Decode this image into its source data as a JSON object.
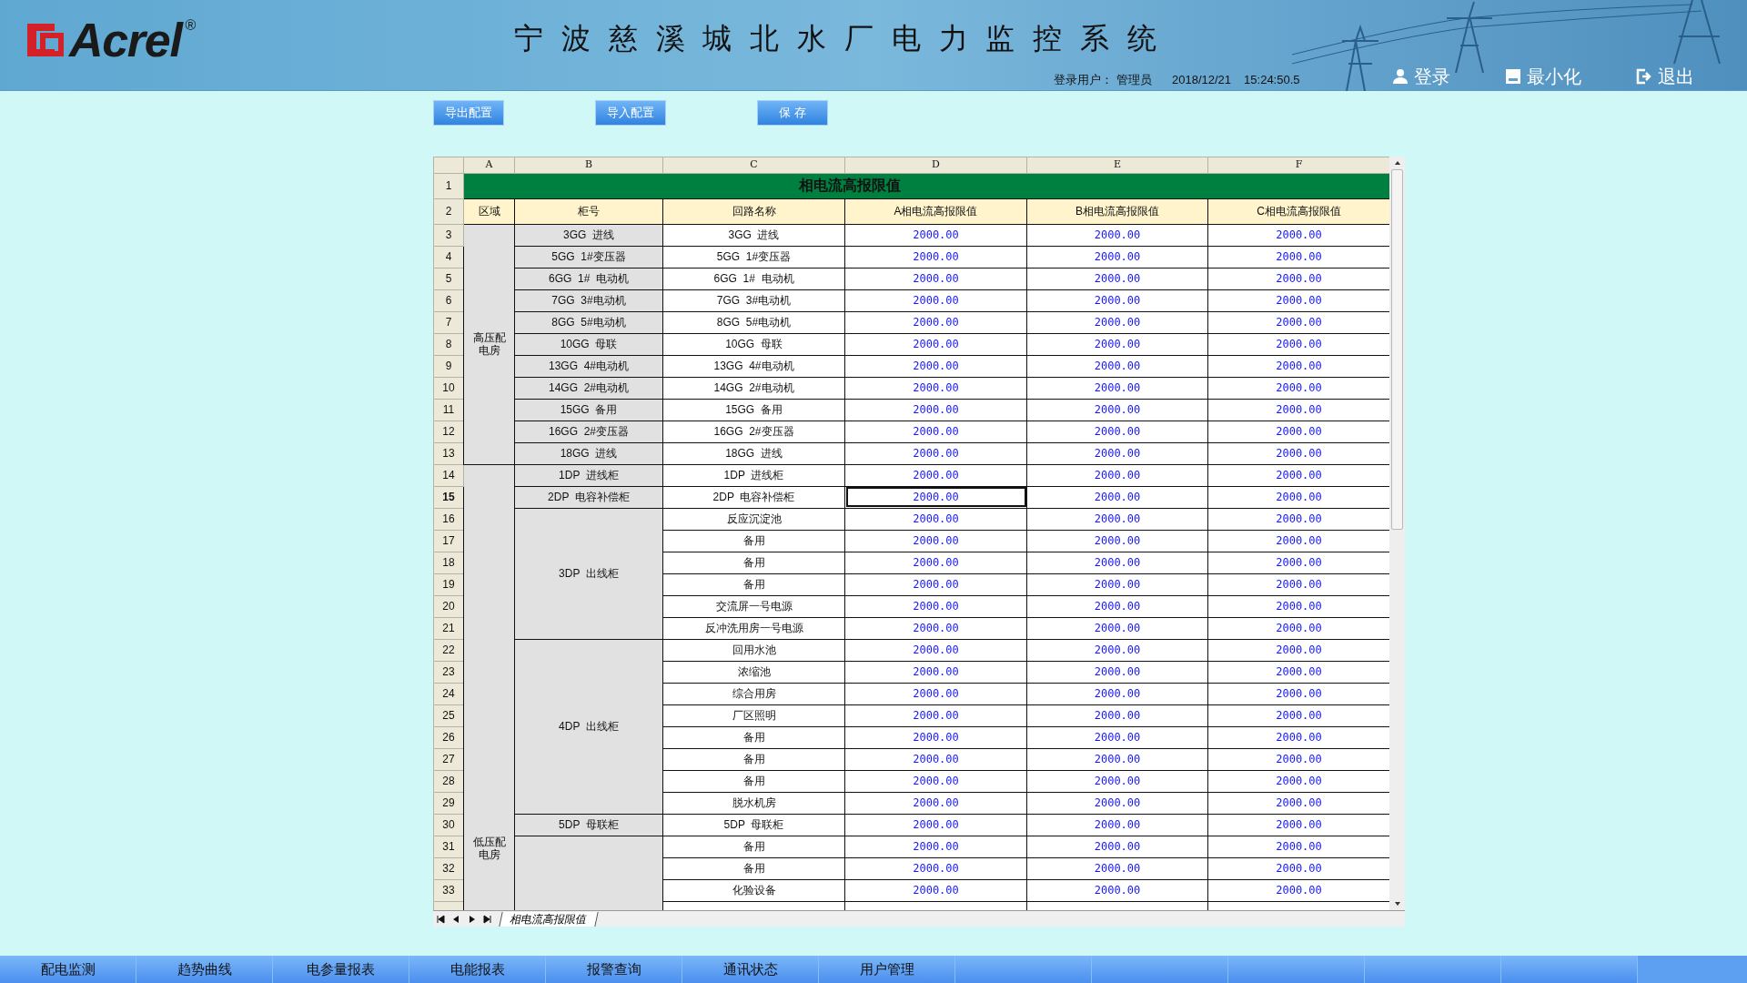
{
  "header": {
    "logo": "Acrel",
    "registered_mark": "®",
    "title": "宁波慈溪城北水厂电力监控系统",
    "user_label": "登录用户：",
    "user": "管理员",
    "date": "2018/12/21",
    "time": "15:24:50.5",
    "actions": [
      {
        "kind": "login",
        "label": "登录"
      },
      {
        "kind": "minimize",
        "label": "最小化"
      },
      {
        "kind": "exit",
        "label": "退出"
      }
    ]
  },
  "toolbar": [
    "导出配置",
    "导入配置",
    "保 存"
  ],
  "sheet": {
    "column_letters": [
      "A",
      "B",
      "C",
      "D",
      "E",
      "F"
    ],
    "row_numbers": [
      "1",
      "2",
      "3",
      "4",
      "5",
      "6",
      "7",
      "8",
      "9",
      "10",
      "11",
      "12",
      "13",
      "14",
      "15",
      "16",
      "17",
      "18",
      "19",
      "20",
      "21",
      "22",
      "23",
      "24",
      "25",
      "26",
      "27",
      "28",
      "29",
      "30",
      "31",
      "32",
      "33"
    ],
    "title": "相电流高报限值",
    "headers": [
      "区域",
      "柜号",
      "回路名称",
      "A相电流高报限值",
      "B相电流高报限值",
      "C相电流高报限值"
    ],
    "regions": [
      {
        "name": "高压配电房",
        "cabinets": [
          {
            "name": "3GG  进线",
            "circuits": [
              {
                "name": "3GG  进线",
                "a": "2000.00",
                "b": "2000.00",
                "c": "2000.00",
                "selected": false
              }
            ]
          },
          {
            "name": "5GG  1#变压器",
            "circuits": [
              {
                "name": "5GG  1#变压器",
                "a": "2000.00",
                "b": "2000.00",
                "c": "2000.00",
                "selected": false
              }
            ]
          },
          {
            "name": "6GG  1#  电动机",
            "circuits": [
              {
                "name": "6GG  1#  电动机",
                "a": "2000.00",
                "b": "2000.00",
                "c": "2000.00",
                "selected": false
              }
            ]
          },
          {
            "name": "7GG  3#电动机",
            "circuits": [
              {
                "name": "7GG  3#电动机",
                "a": "2000.00",
                "b": "2000.00",
                "c": "2000.00",
                "selected": false
              }
            ]
          },
          {
            "name": "8GG  5#电动机",
            "circuits": [
              {
                "name": "8GG  5#电动机",
                "a": "2000.00",
                "b": "2000.00",
                "c": "2000.00",
                "selected": false
              }
            ]
          },
          {
            "name": "10GG  母联",
            "circuits": [
              {
                "name": "10GG  母联",
                "a": "2000.00",
                "b": "2000.00",
                "c": "2000.00",
                "selected": false
              }
            ]
          },
          {
            "name": "13GG  4#电动机",
            "circuits": [
              {
                "name": "13GG  4#电动机",
                "a": "2000.00",
                "b": "2000.00",
                "c": "2000.00",
                "selected": false
              }
            ]
          },
          {
            "name": "14GG  2#电动机",
            "circuits": [
              {
                "name": "14GG  2#电动机",
                "a": "2000.00",
                "b": "2000.00",
                "c": "2000.00",
                "selected": false
              }
            ]
          },
          {
            "name": "15GG  备用",
            "circuits": [
              {
                "name": "15GG  备用",
                "a": "2000.00",
                "b": "2000.00",
                "c": "2000.00",
                "selected": false
              }
            ]
          },
          {
            "name": "16GG  2#变压器",
            "circuits": [
              {
                "name": "16GG  2#变压器",
                "a": "2000.00",
                "b": "2000.00",
                "c": "2000.00",
                "selected": false
              }
            ]
          },
          {
            "name": "18GG  进线",
            "circuits": [
              {
                "name": "18GG  进线",
                "a": "2000.00",
                "b": "2000.00",
                "c": "2000.00",
                "selected": false
              }
            ]
          }
        ]
      },
      {
        "name": "低压配电房",
        "cabinets": [
          {
            "name": "1DP  进线柜",
            "circuits": [
              {
                "name": "1DP  进线柜",
                "a": "2000.00",
                "b": "2000.00",
                "c": "2000.00",
                "selected": false
              }
            ]
          },
          {
            "name": "2DP  电容补偿柜",
            "circuits": [
              {
                "name": "2DP  电容补偿柜",
                "a": "2000.00",
                "b": "2000.00",
                "c": "2000.00",
                "selected": true
              }
            ]
          },
          {
            "name": "3DP  出线柜",
            "circuits": [
              {
                "name": "反应沉淀池",
                "a": "2000.00",
                "b": "2000.00",
                "c": "2000.00",
                "selected": false
              },
              {
                "name": "备用",
                "a": "2000.00",
                "b": "2000.00",
                "c": "2000.00",
                "selected": false
              },
              {
                "name": "备用",
                "a": "2000.00",
                "b": "2000.00",
                "c": "2000.00",
                "selected": false
              },
              {
                "name": "备用",
                "a": "2000.00",
                "b": "2000.00",
                "c": "2000.00",
                "selected": false
              },
              {
                "name": "交流屏一号电源",
                "a": "2000.00",
                "b": "2000.00",
                "c": "2000.00",
                "selected": false
              },
              {
                "name": "反冲洗用房一号电源",
                "a": "2000.00",
                "b": "2000.00",
                "c": "2000.00",
                "selected": false
              }
            ]
          },
          {
            "name": "4DP  出线柜",
            "circuits": [
              {
                "name": "回用水池",
                "a": "2000.00",
                "b": "2000.00",
                "c": "2000.00",
                "selected": false
              },
              {
                "name": "浓缩池",
                "a": "2000.00",
                "b": "2000.00",
                "c": "2000.00",
                "selected": false
              },
              {
                "name": "综合用房",
                "a": "2000.00",
                "b": "2000.00",
                "c": "2000.00",
                "selected": false
              },
              {
                "name": "厂区照明",
                "a": "2000.00",
                "b": "2000.00",
                "c": "2000.00",
                "selected": false
              },
              {
                "name": "备用",
                "a": "2000.00",
                "b": "2000.00",
                "c": "2000.00",
                "selected": false
              },
              {
                "name": "备用",
                "a": "2000.00",
                "b": "2000.00",
                "c": "2000.00",
                "selected": false
              },
              {
                "name": "备用",
                "a": "2000.00",
                "b": "2000.00",
                "c": "2000.00",
                "selected": false
              },
              {
                "name": "脱水机房",
                "a": "2000.00",
                "b": "2000.00",
                "c": "2000.00",
                "selected": false
              }
            ]
          },
          {
            "name": "5DP  母联柜",
            "circuits": [
              {
                "name": "5DP  母联柜",
                "a": "2000.00",
                "b": "2000.00",
                "c": "2000.00",
                "selected": false
              }
            ]
          },
          {
            "circuits": [
              {
                "name": "备用",
                "a": "2000.00",
                "b": "2000.00",
                "c": "2000.00",
                "selected": false
              },
              {
                "name": "备用",
                "a": "2000.00",
                "b": "2000.00",
                "c": "2000.00",
                "selected": false
              },
              {
                "name": "化验设备",
                "a": "2000.00",
                "b": "2000.00",
                "c": "2000.00",
                "selected": false
              }
            ]
          }
        ]
      }
    ],
    "tabs": [
      {
        "label": "相电流高报限值",
        "selected": true
      }
    ]
  },
  "nav": [
    "配电监测",
    "趋势曲线",
    "电参量报表",
    "电能报表",
    "报警查询",
    "通讯状态",
    "用户管理"
  ]
}
